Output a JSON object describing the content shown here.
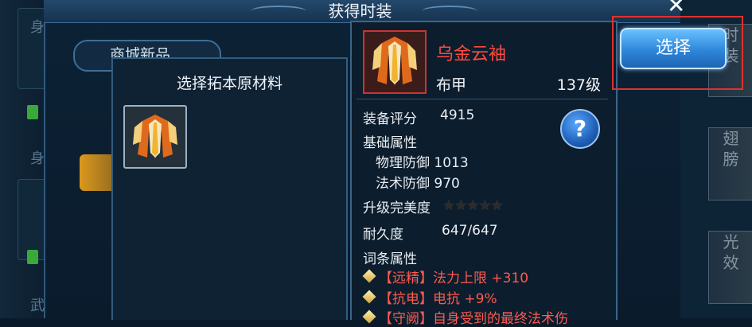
{
  "window": {
    "title": "获得时装"
  },
  "background": {
    "tab_label": "商城新品",
    "left_fragments": [
      "身",
      "身",
      "武"
    ]
  },
  "select_panel": {
    "title": "选择拓本原材料",
    "material_icon": "robe-icon"
  },
  "item": {
    "icon": "robe-icon",
    "name": "乌金云袖",
    "type": "布甲",
    "level": "137级",
    "rating_label": "装备评分",
    "rating_value": "4915",
    "base_label": "基础属性",
    "phys_def": "物理防御 1013",
    "magic_def": "法术防御 970",
    "upgrade_label": "升级完美度",
    "stars": "★★★★★",
    "durability_label": "耐久度",
    "durability_value": "647/647",
    "affix_label": "词条属性",
    "affixes": [
      "【远精】法力上限 +310",
      "【抗电】电抗 +9%",
      "【守阙】自身受到的最终法术伤"
    ]
  },
  "buttons": {
    "help": "?",
    "select": "选择",
    "close": "✕"
  },
  "side_tabs": [
    {
      "lines": [
        "时",
        "装"
      ]
    },
    {
      "lines": [
        "翅",
        "膀"
      ]
    },
    {
      "lines": [
        "光",
        "效"
      ]
    }
  ],
  "colors": {
    "accent_red": "#ff4b40",
    "button_blue": "#2f86d8"
  }
}
